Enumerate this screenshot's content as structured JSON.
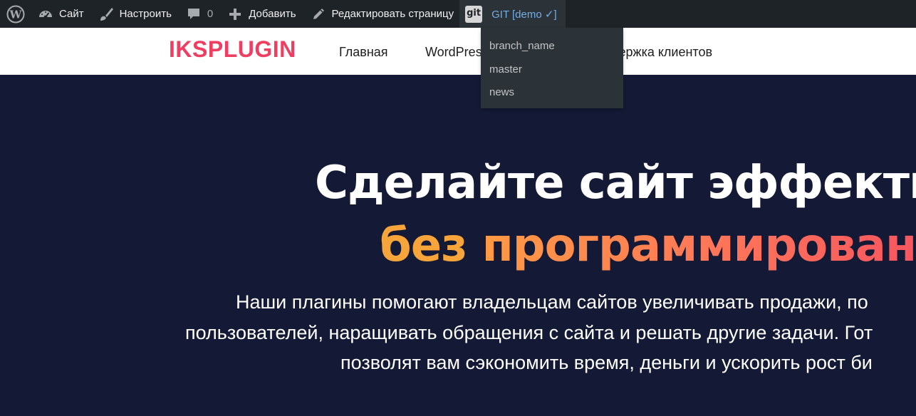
{
  "admin_bar": {
    "site": "Сайт",
    "customize": "Настроить",
    "comments_count": "0",
    "new": "Добавить",
    "edit": "Редактировать страницу",
    "git_icon_text": "git",
    "git_label": "GIT [demo ✓]",
    "icons": [
      "wordpress-icon",
      "dashboard-icon",
      "brush-icon",
      "comment-icon",
      "plus-icon",
      "pencil-icon",
      "git-icon"
    ]
  },
  "git_menu": {
    "items": [
      "branch_name",
      "master",
      "news"
    ]
  },
  "header": {
    "logo": "IKSPLUGIN",
    "nav": [
      "Главная",
      "WordPres",
      "держка клиентов"
    ]
  },
  "hero": {
    "title_line1": "Сделайте сайт эффекти",
    "title_line2_a": "без",
    "title_line2_b": "программирован",
    "subtitle_line1": "Наши плагины помогают владельцам сайтов увеличивать продажи, по",
    "subtitle_line2": "пользователей, наращивать обращения с сайта и решать другие задачи. Гот",
    "subtitle_line3": "позволят вам сэкономить время, деньги и ускорить рост би"
  },
  "colors": {
    "admin_bar_bg": "#1d2327",
    "git_accent": "#72aee6",
    "logo": "#ee3f63",
    "hero_bg": "#141a35",
    "gradient_start": "#f7a43b",
    "gradient_end": "#f6565f"
  }
}
